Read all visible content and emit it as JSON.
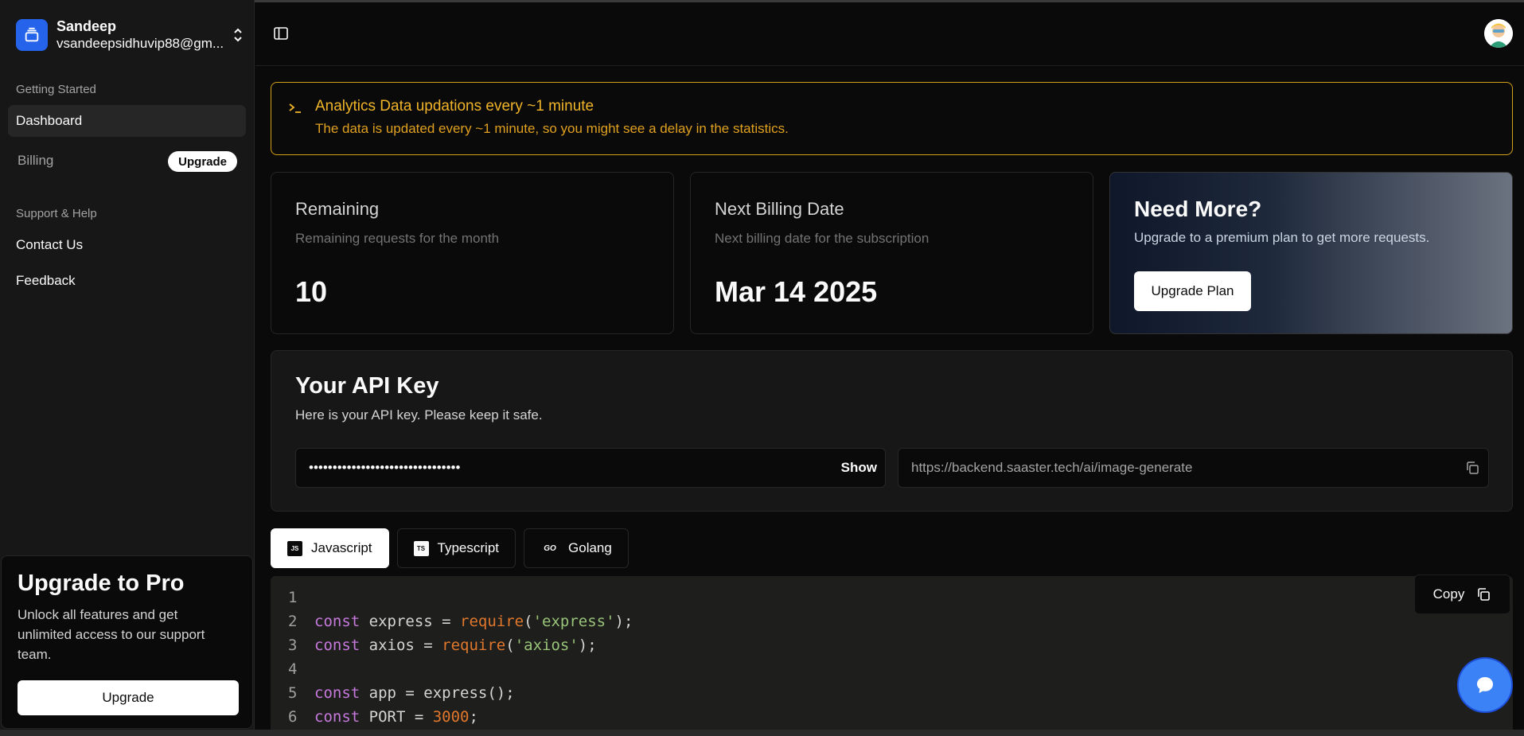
{
  "account": {
    "name": "Sandeep",
    "email": "vsandeepsidhuvip88@gm..."
  },
  "sidebar": {
    "groups": [
      {
        "label": "Getting Started"
      },
      {
        "label": "Support & Help"
      }
    ],
    "items": [
      {
        "label": "Dashboard"
      },
      {
        "label": "Billing",
        "badge": "Upgrade"
      },
      {
        "label": "Contact Us"
      },
      {
        "label": "Feedback"
      }
    ],
    "promo": {
      "title": "Upgrade to Pro",
      "text": "Unlock all features and get unlimited access to our support team.",
      "button": "Upgrade"
    }
  },
  "alert": {
    "title": "Analytics Data updations every ~1 minute",
    "description": "The data is updated every ~1 minute, so you might see a delay in the statistics.",
    "color": "#f0b429"
  },
  "cards": {
    "remaining": {
      "title": "Remaining",
      "subtitle": "Remaining requests for the month",
      "value": "10"
    },
    "billing": {
      "title": "Next Billing Date",
      "subtitle": "Next billing date for the subscription",
      "value": "Mar 14 2025"
    },
    "more": {
      "title": "Need More?",
      "subtitle": "Upgrade to a premium plan to get more requests.",
      "button": "Upgrade Plan"
    }
  },
  "api": {
    "title": "Your API Key",
    "subtitle": "Here is your API key. Please keep it safe.",
    "key_masked": "••••••••••••••••••••••••••••••••",
    "show_label": "Show",
    "endpoint": "https://backend.saaster.tech/ai/image-generate"
  },
  "tabs": [
    {
      "label": "Javascript",
      "icon": "JS"
    },
    {
      "label": "Typescript",
      "icon": "TS"
    },
    {
      "label": "Golang",
      "icon": "GO"
    }
  ],
  "code": {
    "copy_label": "Copy",
    "lines": [
      {
        "n": "1"
      },
      {
        "n": "2",
        "kw": "const",
        "rest1": " express = ",
        "fn": "require",
        "p1": "(",
        "str": "'express'",
        "p2": ");"
      },
      {
        "n": "3",
        "kw": "const",
        "rest1": " axios = ",
        "fn": "require",
        "p1": "(",
        "str": "'axios'",
        "p2": ");"
      },
      {
        "n": "4"
      },
      {
        "n": "5",
        "kw": "const",
        "rest1": " app = express();"
      },
      {
        "n": "6",
        "kw": "const",
        "rest1": " PORT = ",
        "num": "3000",
        "p2": ";"
      }
    ]
  },
  "colors": {
    "accent": "#2563eb",
    "chat": "#3b82f6"
  }
}
